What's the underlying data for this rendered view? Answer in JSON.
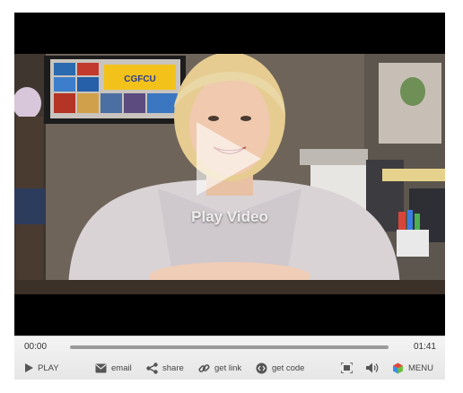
{
  "video": {
    "overlay_label": "Play Video",
    "poster_sign_text": "CGFCU"
  },
  "controls": {
    "current_time": "00:00",
    "total_time": "01:41",
    "progress": 0.0,
    "play_label": "PLAY",
    "email_label": "email",
    "share_label": "share",
    "get_link_label": "get link",
    "get_code_label": "get code",
    "menu_label": "MENU"
  }
}
